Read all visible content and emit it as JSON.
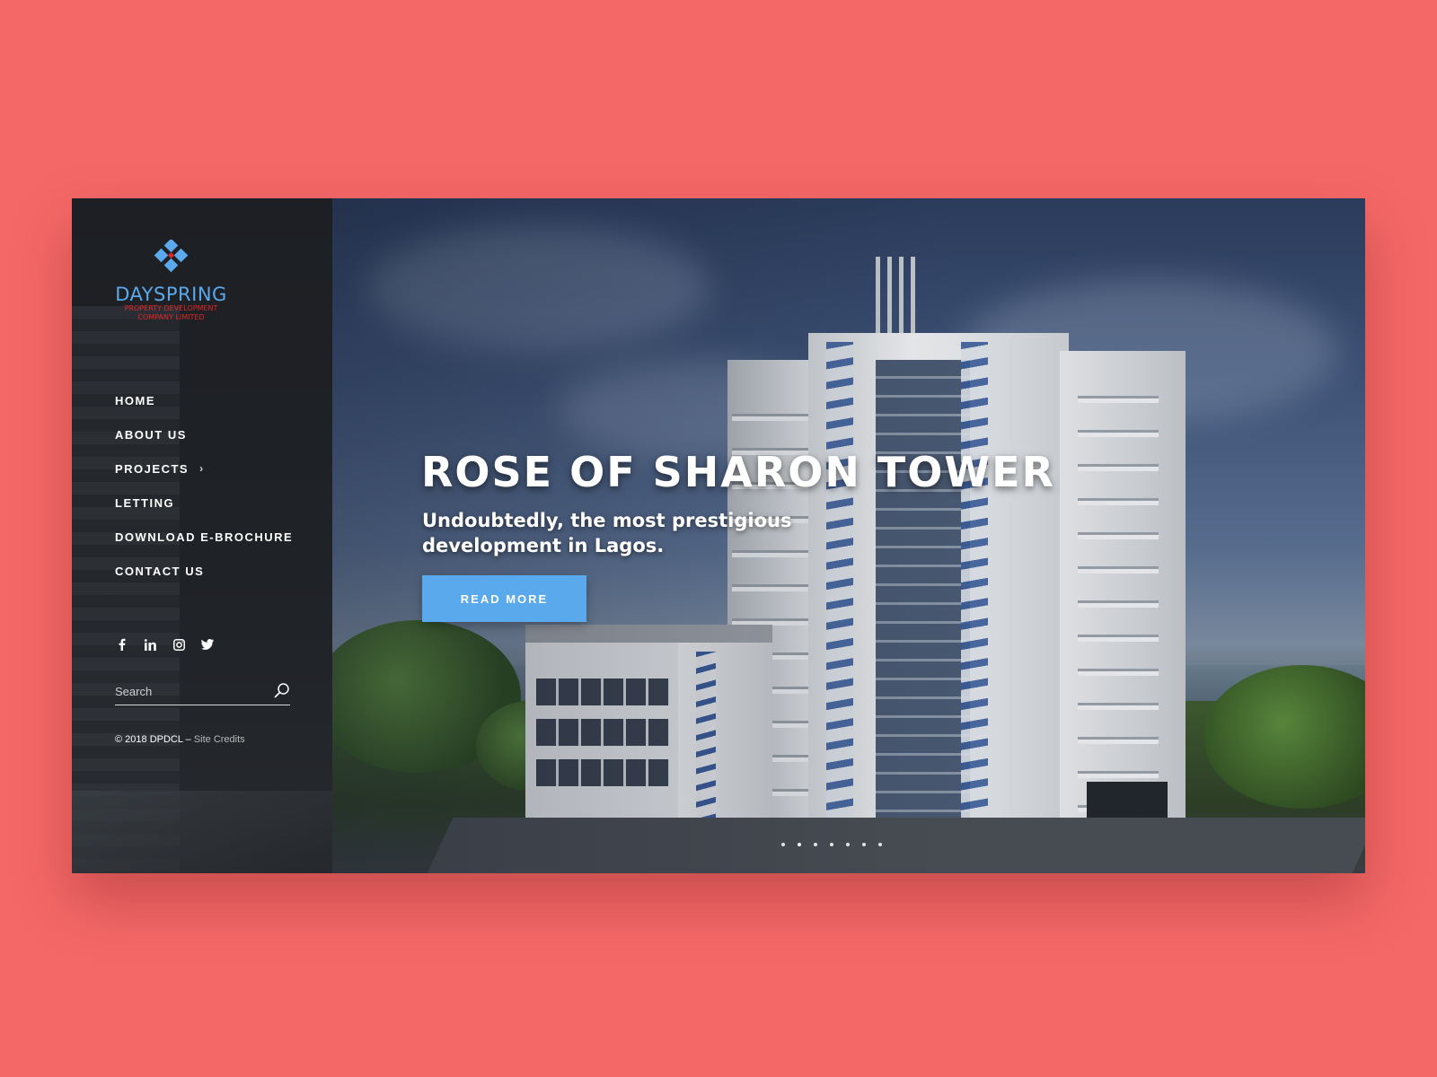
{
  "brand": {
    "name": "DAYSPRING",
    "subtitle_line1": "PROPERTY DEVELOPMENT",
    "subtitle_line2": "COMPANY LIMITED",
    "primary_color": "#5aa9ec",
    "accent_color": "#e02626"
  },
  "nav": {
    "items": [
      {
        "label": "HOME"
      },
      {
        "label": "ABOUT US"
      },
      {
        "label": "PROJECTS",
        "has_submenu": true
      },
      {
        "label": "LETTING"
      },
      {
        "label": "DOWNLOAD E-BROCHURE"
      },
      {
        "label": "CONTACT US"
      }
    ],
    "chevron": "›"
  },
  "social": {
    "icons": [
      "facebook-icon",
      "linkedin-icon",
      "instagram-icon",
      "twitter-icon"
    ]
  },
  "search": {
    "placeholder": "Search",
    "value": ""
  },
  "footer": {
    "copyright": "© 2018 DPDCL –",
    "credits_link": "Site Credits"
  },
  "hero": {
    "headline": "ROSE OF SHARON TOWER",
    "subtitle": "Undoubtedly, the most prestigious development in Lagos.",
    "cta_label": "READ MORE",
    "cta_color": "#5aa9ec",
    "slide_count": 7,
    "active_slide": 1
  },
  "page": {
    "background_color": "#f56868"
  }
}
